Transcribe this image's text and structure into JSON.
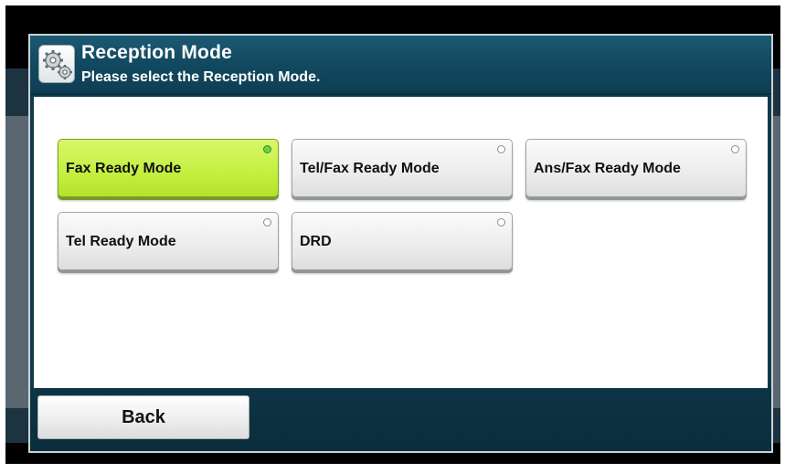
{
  "header": {
    "title": "Reception Mode",
    "subtitle": "Please select the Reception Mode.",
    "icon": "gears-icon"
  },
  "options": [
    {
      "label": "Fax Ready Mode",
      "selected": true
    },
    {
      "label": "Tel/Fax Ready Mode",
      "selected": false
    },
    {
      "label": "Ans/Fax Ready Mode",
      "selected": false
    },
    {
      "label": "Tel Ready Mode",
      "selected": false
    },
    {
      "label": "DRD",
      "selected": false
    }
  ],
  "footer": {
    "back_label": "Back"
  },
  "colors": {
    "selected": "#c4ef3f",
    "header": "#124a61",
    "footer": "#0b2d3c"
  }
}
